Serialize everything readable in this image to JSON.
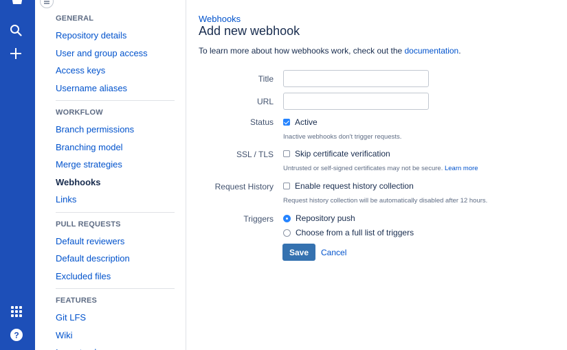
{
  "sidebar": {
    "sections": [
      {
        "title": "GENERAL",
        "items": [
          "Repository details",
          "User and group access",
          "Access keys",
          "Username aliases"
        ]
      },
      {
        "title": "WORKFLOW",
        "items": [
          "Branch permissions",
          "Branching model",
          "Merge strategies",
          "Webhooks",
          "Links"
        ]
      },
      {
        "title": "PULL REQUESTS",
        "items": [
          "Default reviewers",
          "Default description",
          "Excluded files"
        ]
      },
      {
        "title": "FEATURES",
        "items": [
          "Git LFS",
          "Wiki",
          "Issue tracker"
        ]
      }
    ],
    "active_item": "Webhooks"
  },
  "main": {
    "breadcrumb": "Webhooks",
    "title": "Add new webhook",
    "intro_text": "To learn more about how webhooks work, check out the ",
    "intro_link": "documentation",
    "intro_end": ".",
    "form": {
      "title_label": "Title",
      "title_value": "",
      "url_label": "URL",
      "url_value": "",
      "status_label": "Status",
      "status_option": "Active",
      "status_checked": true,
      "status_help": "Inactive webhooks don't trigger requests.",
      "ssl_label": "SSL / TLS",
      "ssl_option": "Skip certificate verification",
      "ssl_checked": false,
      "ssl_help": "Untrusted or self-signed certificates may not be secure. ",
      "ssl_help_link": "Learn more",
      "history_label": "Request History",
      "history_option": "Enable request history collection",
      "history_checked": false,
      "history_help": "Request history collection will be automatically disabled after 12 hours.",
      "triggers_label": "Triggers",
      "trigger_options": [
        "Repository push",
        "Choose from a full list of triggers"
      ],
      "trigger_selected": "Repository push",
      "save_label": "Save",
      "cancel_label": "Cancel"
    }
  },
  "icons": {
    "logo": "bitbucket-logo-icon",
    "search": "search-icon",
    "create": "plus-icon",
    "apps": "app-switcher-icon",
    "help": "help-icon",
    "collapse": "collapse-sidebar-icon"
  },
  "colors": {
    "global_nav": "#1d4fb8",
    "link": "#0052cc",
    "primary_button": "#3572b0",
    "checkbox_checked": "#2684ff"
  }
}
